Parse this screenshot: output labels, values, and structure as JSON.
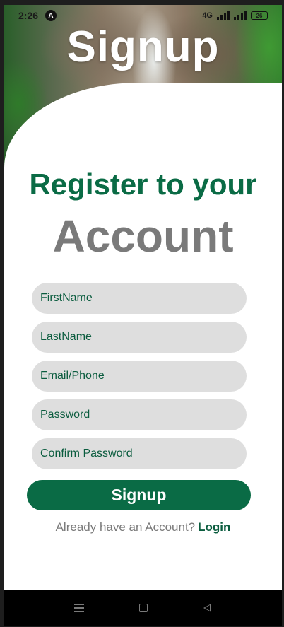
{
  "status_bar": {
    "time": "2:26",
    "app_icon": "A",
    "network": "4G",
    "battery": "26"
  },
  "hero": {
    "title": "Signup"
  },
  "form": {
    "headline": "Register to your",
    "subheadline": "Account",
    "fields": [
      {
        "placeholder": "FirstName",
        "value": ""
      },
      {
        "placeholder": "LastName",
        "value": ""
      },
      {
        "placeholder": "Email/Phone",
        "value": ""
      },
      {
        "placeholder": "Password",
        "value": ""
      },
      {
        "placeholder": "Confirm Password",
        "value": ""
      }
    ],
    "submit_label": "Signup",
    "login_prompt": "Already have an Account?",
    "login_link": "Login"
  },
  "colors": {
    "primary": "#0a6b45",
    "muted_text": "#7a7a7a",
    "field_bg": "#dedede"
  },
  "nav_icons": [
    "menu-icon",
    "home-icon",
    "back-icon"
  ]
}
